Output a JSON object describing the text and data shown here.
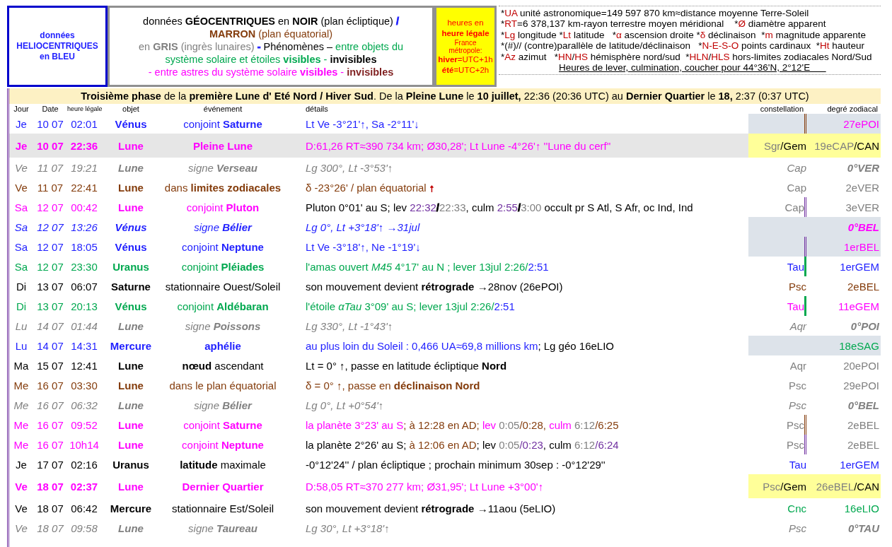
{
  "helio_box": {
    "lines": [
      "données",
      "HELIOCENTRIQUES",
      "en BLEU"
    ]
  },
  "geo_box": {
    "lines": [
      [
        {
          "text": "données **GÉOCENTRIQUES** en **NOIR** (plan écliptique)  ",
          "color": "#000000"
        },
        {
          "text": "/",
          "color": "#1f1fff"
        }
      ],
      [
        {
          "text": "**MARRON** (plan équatorial)",
          "color": "#843c0c"
        }
      ],
      [
        {
          "text": "en **GRIS** (ingrès lunaires)  ",
          "color": "#808080"
        },
        {
          "text": "-",
          "color": "#1f1fff"
        },
        {
          "text": "  Phénomènes – ",
          "color": "#000000"
        },
        {
          "text": "entre objets du",
          "color": "#00a84f"
        }
      ],
      [
        {
          "text": "système solaire et étoiles **visibles** - ",
          "color": "#00a84f"
        },
        {
          "text": "**invisibles**",
          "color": "#000000"
        }
      ],
      [
        {
          "text": "- entre astres du système solaire **visibles** - ",
          "color": "#ff00ff"
        },
        {
          "text": "**invisibles**",
          "color": "#7f1f1f"
        }
      ]
    ]
  },
  "time_box": {
    "lines": [
      {
        "text": "heures en",
        "kind": "normal"
      },
      {
        "text": "**heure légale**",
        "kind": "normal"
      },
      {
        "text": "France",
        "kind": "small"
      },
      {
        "text": "métropole:",
        "kind": "small"
      },
      {
        "text": "**hiver**=UTC+1h",
        "kind": "normal"
      },
      {
        "text": "**été**=UTC+2h",
        "kind": "normal"
      }
    ]
  },
  "legend": {
    "lines": [
      {
        "kind": "plain",
        "segments": [
          {
            "text": "*",
            "kind": "plain"
          },
          {
            "text": "UA",
            "kind": "abbr"
          },
          {
            "text": " unité astronomique=149 597 870 km≈distance moyenne Terre-Soleil",
            "kind": "plain"
          }
        ]
      },
      {
        "kind": "plain",
        "segments": [
          {
            "text": "*",
            "kind": "plain"
          },
          {
            "text": "RT",
            "kind": "abbr"
          },
          {
            "text": "=6 378,137 km-rayon terrestre moyen méridional    *",
            "kind": "plain"
          },
          {
            "text": "Ø",
            "kind": "abbr"
          },
          {
            "text": " diamètre apparent",
            "kind": "plain"
          }
        ]
      },
      {
        "kind": "plain",
        "segments": [
          {
            "text": "*",
            "kind": "plain"
          },
          {
            "text": "Lg",
            "kind": "abbr"
          },
          {
            "text": " longitude *",
            "kind": "plain"
          },
          {
            "text": "Lt",
            "kind": "abbr"
          },
          {
            "text": " latitude   *",
            "kind": "plain"
          },
          {
            "text": "α",
            "kind": "abbr"
          },
          {
            "text": " ascension droite *",
            "kind": "plain"
          },
          {
            "text": "δ",
            "kind": "abbr"
          },
          {
            "text": " déclinaison  *",
            "kind": "plain"
          },
          {
            "text": "m",
            "kind": "abbr"
          },
          {
            "text": " magnitude apparente",
            "kind": "plain"
          }
        ]
      },
      {
        "kind": "plain",
        "segments": [
          {
            "text": "*(#)// (contre)parallèle de latitude/déclinaison   *",
            "kind": "plain"
          },
          {
            "text": "N-E-S-O",
            "kind": "abbr"
          },
          {
            "text": " points cardinaux  *",
            "kind": "plain"
          },
          {
            "text": "Ht",
            "kind": "abbr"
          },
          {
            "text": " hauteur",
            "kind": "plain"
          }
        ]
      },
      {
        "kind": "plain",
        "segments": [
          {
            "text": "*",
            "kind": "plain"
          },
          {
            "text": "Az",
            "kind": "abbr"
          },
          {
            "text": " azimut   *",
            "kind": "plain"
          },
          {
            "text": "HN",
            "kind": "abbr"
          },
          {
            "text": "/",
            "kind": "plain"
          },
          {
            "text": "HS",
            "kind": "abbr"
          },
          {
            "text": " hémisphère nord/sud  *",
            "kind": "plain"
          },
          {
            "text": "HLN",
            "kind": "abbr"
          },
          {
            "text": "/",
            "kind": "plain"
          },
          {
            "text": "HLS",
            "kind": "abbr"
          },
          {
            "text": " hors-limites zodiacales Nord/Sud",
            "kind": "plain"
          }
        ]
      },
      {
        "kind": "underlined",
        "segments": [
          {
            "text": "Heures de lever, culmination, coucher pour 44°36'N, 2°12'E      ",
            "kind": "plain"
          }
        ]
      }
    ]
  },
  "banner": "**Troisième phase** de la **première Lune d' Eté Nord / Hiver Sud**. De la **Pleine Lune** le **10 juillet,** 22:36 (20:36 UTC) au **Dernier Quartier** le **18,** 2:37 (0:37 UTC)",
  "columns": [
    "Jour",
    "Date",
    "heure légale",
    "objet",
    "événement",
    "détails",
    "constellation",
    "degré zodiacal"
  ],
  "rows": [
    {
      "day": "Je",
      "date": "10 07",
      "time": "02:01",
      "object": "Vénus",
      "event": "conjoint **Saturne**",
      "color": "#1f1fff",
      "italic": false,
      "bold": false,
      "highlighted": false,
      "kind": "heliocentric",
      "details": [
        {
          "text": "Lt Ve -3°21'↑, Sa -2°11'↓",
          "color": "#1f1fff"
        }
      ],
      "constellation": [],
      "degree": [
        {
          "text": "27ePOI",
          "color": "#ff00ff"
        }
      ],
      "marker": {
        "kind": "double",
        "color": "#843c0c"
      }
    },
    {
      "day": "Je",
      "date": "10 07",
      "time": "22:36",
      "object": "Lune",
      "event": "Pleine Lune",
      "color": "#ff00ff",
      "italic": false,
      "bold": true,
      "highlighted": true,
      "kind": "phase",
      "details": [
        {
          "text": "D:61,26 RT≈390 734 km; Ø30,28'; Lt Lune -4°26'↑ ''Lune du cerf''",
          "color": "#ff00ff"
        }
      ],
      "constellation": [
        {
          "text": "Sgr",
          "color": "#808080"
        },
        {
          "text": "/Gem",
          "color": "#000000"
        }
      ],
      "degree": [
        {
          "text": "19eCAP",
          "color": "#808080"
        },
        {
          "text": "/CAN",
          "color": "#000000"
        }
      ]
    },
    {
      "day": "Ve",
      "date": "11 07",
      "time": "19:21",
      "object": "Lune",
      "event": "signe **Verseau**",
      "color": "#808080",
      "italic": true,
      "bold": false,
      "highlighted": false,
      "details": [
        {
          "text": "Lg 300°, Lt -3°53'↑",
          "color": "#808080"
        }
      ],
      "constellation": [
        {
          "text": "Cap",
          "color": "#808080"
        }
      ],
      "degree": [
        {
          "text": "0°VER",
          "color": "#808080"
        }
      ]
    },
    {
      "day": "Ve",
      "date": "11 07",
      "time": "22:41",
      "object": "Lune",
      "event": "dans **limites zodiacales**",
      "color": "#843c0c",
      "italic": false,
      "bold": false,
      "highlighted": false,
      "details": [
        {
          "text": "δ -23°26' / plan équatorial ",
          "color": "#843c0c"
        },
        {
          "text": "↑",
          "color": "#c00000"
        }
      ],
      "constellation": [
        {
          "text": "Cap",
          "color": "#808080"
        }
      ],
      "degree": [
        {
          "text": "2eVER",
          "color": "#808080"
        }
      ]
    },
    {
      "day": "Sa",
      "date": "12 07",
      "time": "00:42",
      "object": "Lune",
      "event": "conjoint **Pluton**",
      "color": "#ff00ff",
      "italic": false,
      "bold": false,
      "highlighted": false,
      "details": [
        {
          "text": "Pluton 0°01' au S; lev ",
          "color": "#000000"
        },
        {
          "text": "22:32",
          "color": "#7030a0"
        },
        {
          "text": "/",
          "color": "#000000"
        },
        {
          "text": "22:33",
          "color": "#808080"
        },
        {
          "text": ", culm ",
          "color": "#000000"
        },
        {
          "text": "2:55",
          "color": "#7030a0"
        },
        {
          "text": "/",
          "color": "#000000"
        },
        {
          "text": "3:00",
          "color": "#808080"
        },
        {
          "text": " occult pr S Atl, S Afr, oc Ind, Ind",
          "color": "#000000"
        }
      ],
      "constellation": [
        {
          "text": "Cap",
          "color": "#808080"
        }
      ],
      "degree": [
        {
          "text": "3eVER",
          "color": "#808080"
        }
      ],
      "marker": {
        "kind": "double",
        "color": "#7030a0"
      }
    },
    {
      "day": "Sa",
      "date": "12 07",
      "time": "13:26",
      "object": "Vénus",
      "event": "signe **Bélier**",
      "color": "#1f1fff",
      "italic": true,
      "bold": false,
      "highlighted": false,
      "kind": "heliocentric",
      "details": [
        {
          "text": "Lg 0°, Lt +3°18'↑ →31jul",
          "color": "#1f1fff"
        }
      ],
      "constellation": [],
      "degree": [
        {
          "text": "0°BEL",
          "color": "#ff00ff"
        }
      ]
    },
    {
      "day": "Sa",
      "date": "12 07",
      "time": "18:05",
      "object": "Vénus",
      "event": "conjoint **Neptune**",
      "color": "#1f1fff",
      "italic": false,
      "bold": false,
      "highlighted": false,
      "kind": "heliocentric",
      "details": [
        {
          "text": "Lt Ve -3°18'↑, Ne -1°19'↓",
          "color": "#1f1fff"
        }
      ],
      "constellation": [],
      "degree": [
        {
          "text": "1erBEL",
          "color": "#ff00ff"
        }
      ],
      "marker": {
        "kind": "double",
        "color": "#7030a0"
      }
    },
    {
      "day": "Sa",
      "date": "12 07",
      "time": "23:30",
      "object": "Uranus",
      "event": "conjoint **Pléiades**",
      "color": "#00a84f",
      "italic": false,
      "bold": false,
      "highlighted": false,
      "details": [
        {
          "text": "l'amas ouvert *M45* 4°17' au N ; lever 13jul 2:26/",
          "color": "#00a84f"
        },
        {
          "text": "2:51",
          "color": "#1f1fff"
        }
      ],
      "constellation": [
        {
          "text": "Tau",
          "color": "#1f1fff"
        }
      ],
      "degree": [
        {
          "text": "1erGEM",
          "color": "#1f1fff"
        }
      ],
      "marker": {
        "kind": "bar",
        "color": "#00a84f"
      }
    },
    {
      "day": "Di",
      "date": "13 07",
      "time": "06:07",
      "object": "Saturne",
      "event": "stationnaire Ouest/Soleil",
      "color": "#000000",
      "italic": false,
      "bold": false,
      "highlighted": false,
      "details": [
        {
          "text": "son mouvement devient **rétrograde** →28nov (26ePOI)",
          "color": "#000000"
        }
      ],
      "constellation": [
        {
          "text": "Psc",
          "color": "#843c0c"
        }
      ],
      "degree": [
        {
          "text": "2eBEL",
          "color": "#843c0c"
        }
      ]
    },
    {
      "day": "Di",
      "date": "13 07",
      "time": "20:13",
      "object": "Vénus",
      "event": "conjoint **Aldébaran**",
      "color": "#00a84f",
      "italic": false,
      "bold": false,
      "highlighted": false,
      "details": [
        {
          "text": "l'étoile *αTau* 3°09' au S; lever 13jul 2:26/",
          "color": "#00a84f"
        },
        {
          "text": "2:51",
          "color": "#1f1fff"
        }
      ],
      "constellation": [
        {
          "text": "Tau",
          "color": "#ff00ff"
        }
      ],
      "degree": [
        {
          "text": "11eGEM",
          "color": "#ff00ff"
        }
      ],
      "marker": {
        "kind": "bar",
        "color": "#00a84f"
      }
    },
    {
      "day": "Lu",
      "date": "14 07",
      "time": "01:44",
      "object": "Lune",
      "event": "signe **Poissons**",
      "color": "#808080",
      "italic": true,
      "bold": false,
      "highlighted": false,
      "details": [
        {
          "text": "Lg 330°, Lt -1°43'↑",
          "color": "#808080"
        }
      ],
      "constellation": [
        {
          "text": "Aqr",
          "color": "#808080"
        }
      ],
      "degree": [
        {
          "text": "0°POI",
          "color": "#808080"
        }
      ]
    },
    {
      "day": "Lu",
      "date": "14 07",
      "time": "14:31",
      "object": "Mercure",
      "event": "**aphélie**",
      "color": "#1f1fff",
      "italic": false,
      "bold": false,
      "highlighted": false,
      "kind": "heliocentric",
      "details": [
        {
          "text": "au plus loin du Soleil : 0,466 UA≈69,8 millions km",
          "color": "#1f1fff"
        },
        {
          "text": "; Lg géo 16eLIO",
          "color": "#000000"
        }
      ],
      "constellation": [],
      "degree": [
        {
          "text": "18eSAG",
          "color": "#00a84f"
        }
      ]
    },
    {
      "day": "Ma",
      "date": "15 07",
      "time": "12:41",
      "object": "Lune",
      "event": "**nœud** ascendant",
      "color": "#000000",
      "italic": false,
      "bold": false,
      "highlighted": false,
      "details": [
        {
          "text": "Lt = 0° ↑, passe en latitude écliptique **Nord**",
          "color": "#000000"
        }
      ],
      "constellation": [
        {
          "text": "Aqr",
          "color": "#808080"
        }
      ],
      "degree": [
        {
          "text": "20ePOI",
          "color": "#808080"
        }
      ]
    },
    {
      "day": "Me",
      "date": "16 07",
      "time": "03:30",
      "object": "Lune",
      "event": "dans le plan équatorial",
      "color": "#843c0c",
      "italic": false,
      "bold": false,
      "highlighted": false,
      "details": [
        {
          "text": "δ = 0° ↑, passe en **déclinaison Nord**",
          "color": "#843c0c"
        }
      ],
      "constellation": [
        {
          "text": "Psc",
          "color": "#808080"
        }
      ],
      "degree": [
        {
          "text": "29ePOI",
          "color": "#808080"
        }
      ]
    },
    {
      "day": "Me",
      "date": "16 07",
      "time": "06:32",
      "object": "Lune",
      "event": "signe **Bélier**",
      "color": "#808080",
      "italic": true,
      "bold": false,
      "highlighted": false,
      "details": [
        {
          "text": "Lg 0°, Lt +0°54'↑",
          "color": "#808080"
        }
      ],
      "constellation": [
        {
          "text": "Psc",
          "color": "#808080"
        }
      ],
      "degree": [
        {
          "text": "0°BEL",
          "color": "#808080"
        }
      ]
    },
    {
      "day": "Me",
      "date": "16 07",
      "time": "09:52",
      "object": "Lune",
      "event": "conjoint **Saturne**",
      "color": "#ff00ff",
      "italic": false,
      "bold": false,
      "highlighted": false,
      "details": [
        {
          "text": "la planète 3°23' au S",
          "color": "#ff00ff"
        },
        {
          "text": "; à 12:28 en AD; ",
          "color": "#843c0c"
        },
        {
          "text": "lev ",
          "color": "#ff00ff"
        },
        {
          "text": "0:05",
          "color": "#808080"
        },
        {
          "text": "/0:28, ",
          "color": "#843c0c"
        },
        {
          "text": "culm ",
          "color": "#ff00ff"
        },
        {
          "text": "6:12",
          "color": "#808080"
        },
        {
          "text": "/6:25",
          "color": "#843c0c"
        }
      ],
      "constellation": [
        {
          "text": "Psc",
          "color": "#808080"
        }
      ],
      "degree": [
        {
          "text": "2eBEL",
          "color": "#808080"
        }
      ],
      "marker": {
        "kind": "double",
        "color": "#843c0c"
      }
    },
    {
      "day": "Me",
      "date": "16 07",
      "time": "10h14",
      "object": "Lune",
      "event": "conjoint **Neptune**",
      "color": "#ff00ff",
      "italic": false,
      "bold": false,
      "highlighted": false,
      "details": [
        {
          "text": "la planète 2°26' au S; ",
          "color": "#000000"
        },
        {
          "text": "à 12:06 en AD",
          "color": "#843c0c"
        },
        {
          "text": "; lev ",
          "color": "#000000"
        },
        {
          "text": "0:05",
          "color": "#808080"
        },
        {
          "text": "/0:23",
          "color": "#7030a0"
        },
        {
          "text": ", culm ",
          "color": "#000000"
        },
        {
          "text": "6:12",
          "color": "#808080"
        },
        {
          "text": "/6:24",
          "color": "#7030a0"
        }
      ],
      "constellation": [
        {
          "text": "Psc",
          "color": "#808080"
        }
      ],
      "degree": [
        {
          "text": "2eBEL",
          "color": "#808080"
        }
      ],
      "marker": {
        "kind": "double",
        "color": "#7030a0"
      }
    },
    {
      "day": "Je",
      "date": "17 07",
      "time": "02:16",
      "object": "Uranus",
      "event": "**latitude** maximale",
      "color": "#000000",
      "italic": false,
      "bold": false,
      "highlighted": false,
      "details": [
        {
          "text": "-0°12'24'' / plan écliptique ; prochain minimum 30sep : -0°12'29''",
          "color": "#000000"
        }
      ],
      "constellation": [
        {
          "text": "Tau",
          "color": "#1f1fff"
        }
      ],
      "degree": [
        {
          "text": "1erGEM",
          "color": "#1f1fff"
        }
      ]
    },
    {
      "day": "Ve",
      "date": "18 07",
      "time": "02:37",
      "object": "Lune",
      "event": "Dernier Quartier",
      "color": "#ff00ff",
      "italic": false,
      "bold": true,
      "highlighted": false,
      "kind": "phase",
      "details": [
        {
          "text": "D:58,05 RT≈370 277 km; Ø31,95'; Lt Lune +3°00'↑",
          "color": "#ff00ff"
        }
      ],
      "constellation": [
        {
          "text": "Psc",
          "color": "#808080"
        },
        {
          "text": "/Gem",
          "color": "#000000"
        }
      ],
      "degree": [
        {
          "text": "26eBEL",
          "color": "#808080"
        },
        {
          "text": "/CAN",
          "color": "#000000"
        }
      ]
    },
    {
      "day": "Ve",
      "date": "18 07",
      "time": "06:42",
      "object": "Mercure",
      "event": "stationnaire Est/Soleil",
      "color": "#000000",
      "italic": false,
      "bold": false,
      "highlighted": false,
      "details": [
        {
          "text": "son mouvement devient **rétrograde** →11aou (5eLIO)",
          "color": "#000000"
        }
      ],
      "constellation": [
        {
          "text": "Cnc",
          "color": "#00a84f"
        }
      ],
      "degree": [
        {
          "text": "16eLIO",
          "color": "#00a84f"
        }
      ]
    },
    {
      "day": "Ve",
      "date": "18 07",
      "time": "09:58",
      "object": "Lune",
      "event": "signe **Taureau**",
      "color": "#808080",
      "italic": true,
      "bold": false,
      "highlighted": false,
      "details": [
        {
          "text": "Lg 30°, Lt +3°18'↑",
          "color": "#808080"
        }
      ],
      "constellation": [
        {
          "text": "Psc",
          "color": "#808080"
        }
      ],
      "degree": [
        {
          "text": "0°TAU",
          "color": "#808080"
        }
      ]
    }
  ]
}
